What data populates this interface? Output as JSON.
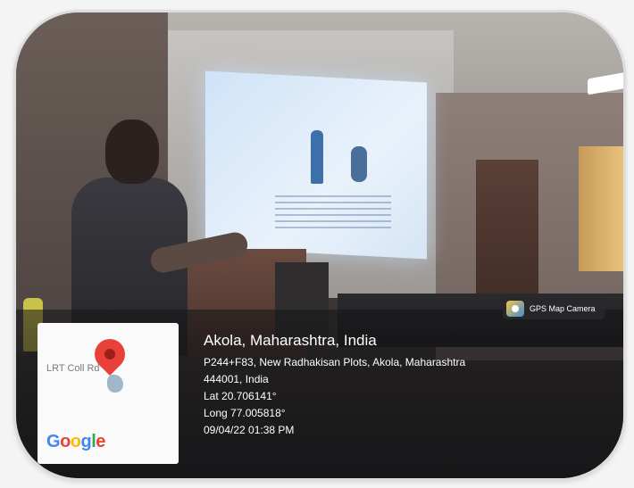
{
  "badge": {
    "label": "GPS Map Camera",
    "icon": "camera-pin-icon"
  },
  "map": {
    "road_label": "LRT Coll    Rd",
    "google_letters": [
      "G",
      "o",
      "o",
      "g",
      "l",
      "e"
    ]
  },
  "location": {
    "title": "Akola, Maharashtra, India",
    "address_line1": "P244+F83, New Radhakisan Plots, Akola, Maharashtra",
    "address_line2": "444001, India",
    "lat": "Lat 20.706141°",
    "long": "Long 77.005818°",
    "datetime": "09/04/22 01:38 PM"
  }
}
